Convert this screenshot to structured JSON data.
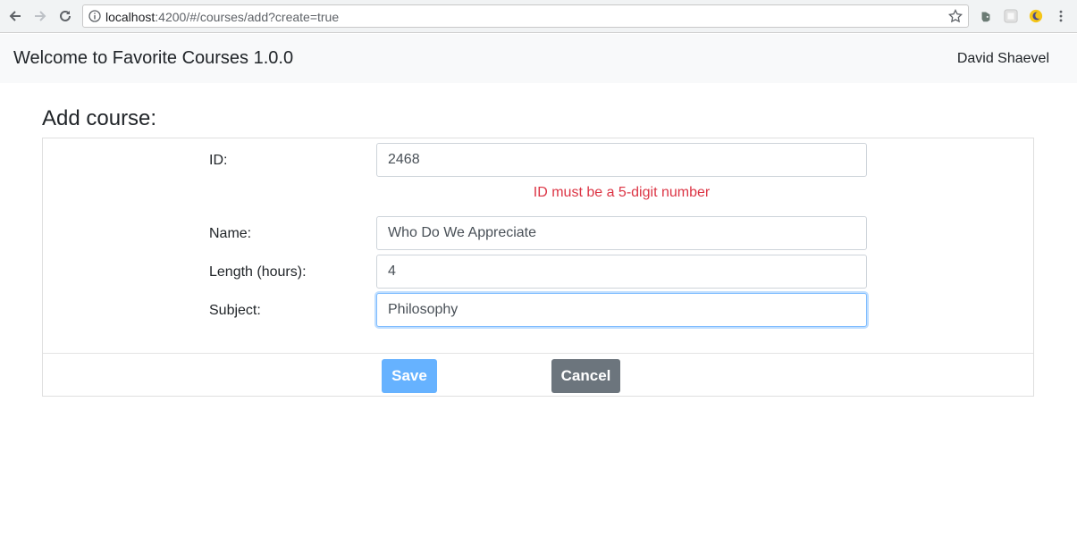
{
  "browser": {
    "url_host": "localhost",
    "url_rest": ":4200/#/courses/add?create=true"
  },
  "navbar": {
    "brand": "Welcome to Favorite Courses 1.0.0",
    "user": "David Shaevel"
  },
  "form": {
    "title": "Add course:",
    "id_label": "ID:",
    "id_value": "2468",
    "id_error": "ID must be a 5-digit number",
    "name_label": "Name:",
    "name_value": "Who Do We Appreciate",
    "length_label": "Length (hours):",
    "length_value": "4",
    "subject_label": "Subject:",
    "subject_value": "Philosophy",
    "save_label": "Save",
    "cancel_label": "Cancel"
  },
  "colors": {
    "error": "#dc3545",
    "save_button": "#66b2ff",
    "cancel_button": "#6c757d",
    "focus_border": "#80bdff"
  }
}
